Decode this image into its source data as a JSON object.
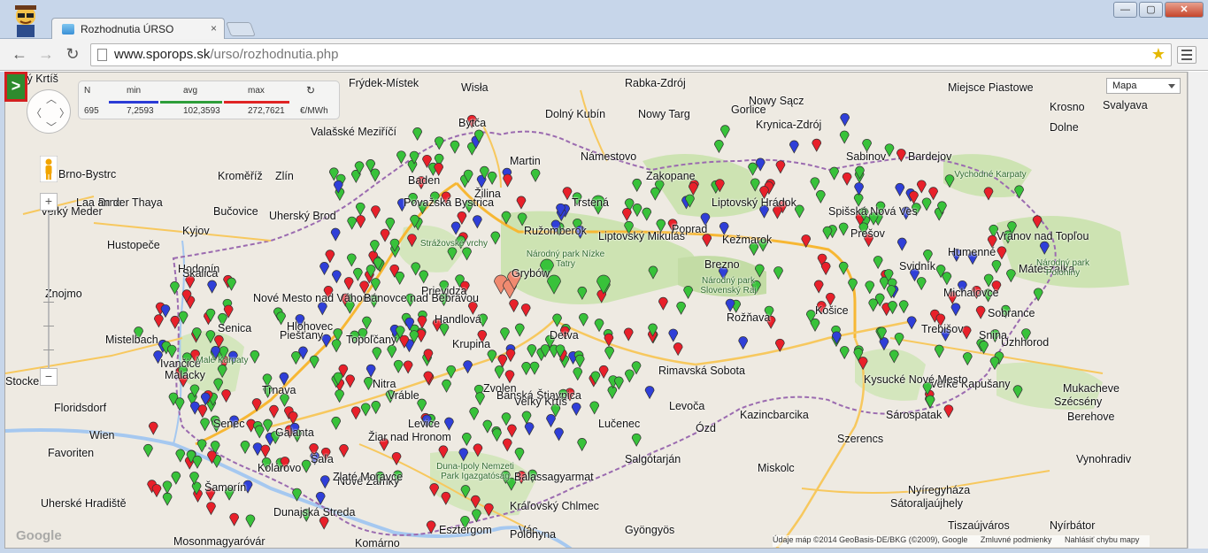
{
  "window": {
    "tab_title": "Rozhodnutia ÚRSO",
    "tab_close": "×",
    "minimize": "—",
    "maximize": "▢",
    "close": "✕"
  },
  "toolbar": {
    "back": "←",
    "forward": "→",
    "reload": "↻",
    "url_host": "www.sporops.sk",
    "url_path": "/urso/rozhodnutia.php",
    "bookmark_icon": "star-icon"
  },
  "map": {
    "toggle_label": ">",
    "map_type": "Mapa",
    "stats": {
      "n_label": "N",
      "min_label": "min",
      "avg_label": "avg",
      "max_label": "max",
      "n_value": "695",
      "min_value": "7,2593",
      "avg_value": "102,3593",
      "max_value": "272,7621",
      "unit": "€/MWh",
      "refresh_icon": "↻",
      "colors": {
        "min": "#2b3bd6",
        "avg": "#2e9e3a",
        "max": "#e02424"
      }
    },
    "footer": {
      "data": "Údaje máp ©2014 GeoBasis-DE/BKG (©2009), Google",
      "terms": "Zmluvné podmienky",
      "report": "Nahlásiť chybu mapy"
    },
    "logo": "Google",
    "marker_colors": {
      "red": "#e8202a",
      "green": "#38c23a",
      "blue": "#2f3fd8",
      "salmon": "#f08a70"
    },
    "labels": [
      {
        "t": "Frýdek-Místek",
        "k": "city"
      },
      {
        "t": "Wisła",
        "k": "city"
      },
      {
        "t": "Rabka-Zdrój",
        "k": "city"
      },
      {
        "t": "Nowy Targ",
        "k": "city"
      },
      {
        "t": "Zakopane",
        "k": "city"
      },
      {
        "t": "Krynica-Zdrój",
        "k": "city"
      },
      {
        "t": "Miejsce Piastowe",
        "k": "city"
      },
      {
        "t": "Krosno",
        "k": "city"
      },
      {
        "t": "Dolne",
        "k": "city"
      },
      {
        "t": "Brno-Bystrc",
        "k": "city"
      },
      {
        "t": "Brno",
        "k": "city"
      },
      {
        "t": "Zlín",
        "k": "city"
      },
      {
        "t": "Kroměříž",
        "k": "city"
      },
      {
        "t": "Valašské Meziříčí",
        "k": "city"
      },
      {
        "t": "Uherský Brod",
        "k": "city"
      },
      {
        "t": "Kyjov",
        "k": "city"
      },
      {
        "t": "Hustopeče",
        "k": "city"
      },
      {
        "t": "Hodonín",
        "k": "city"
      },
      {
        "t": "Mistelbach",
        "k": "city"
      },
      {
        "t": "Wien",
        "k": "city"
      },
      {
        "t": "Floridsdorf",
        "k": "city"
      },
      {
        "t": "Favoriten",
        "k": "city"
      },
      {
        "t": "Stockerau",
        "k": "city"
      },
      {
        "t": "Ružomberok",
        "k": "city"
      },
      {
        "t": "Poprad",
        "k": "city"
      },
      {
        "t": "Prešov",
        "k": "city"
      },
      {
        "t": "Košice",
        "k": "city"
      },
      {
        "t": "Humenné",
        "k": "city"
      },
      {
        "t": "Michalovce",
        "k": "city"
      },
      {
        "t": "Sobrance",
        "k": "city"
      },
      {
        "t": "Uzhhorod",
        "k": "city"
      },
      {
        "t": "Mukacheve",
        "k": "city"
      },
      {
        "t": "Berehove",
        "k": "city"
      },
      {
        "t": "Vynohradiv",
        "k": "city"
      },
      {
        "t": "Trebišov",
        "k": "city"
      },
      {
        "t": "Sárospatak",
        "k": "city"
      },
      {
        "t": "Szerencs",
        "k": "city"
      },
      {
        "t": "Miskolc",
        "k": "city"
      },
      {
        "t": "Nyíregyháza",
        "k": "city"
      },
      {
        "t": "Kazincbarcika",
        "k": "city"
      },
      {
        "t": "Ózd",
        "k": "city"
      },
      {
        "t": "Salgótarján",
        "k": "city"
      },
      {
        "t": "Gyöngyös",
        "k": "city"
      },
      {
        "t": "Balassagyarmat",
        "k": "city"
      },
      {
        "t": "Vác",
        "k": "city"
      },
      {
        "t": "Esztergom",
        "k": "city"
      },
      {
        "t": "Komárno",
        "k": "city"
      },
      {
        "t": "Mosonmagyaróvár",
        "k": "city"
      },
      {
        "t": "Šamorín",
        "k": "city"
      },
      {
        "t": "Senec",
        "k": "city"
      },
      {
        "t": "Trnava",
        "k": "city"
      },
      {
        "t": "Nitra",
        "k": "city"
      },
      {
        "t": "Galanta",
        "k": "city"
      },
      {
        "t": "Šaľa",
        "k": "city"
      },
      {
        "t": "Nové Zámky",
        "k": "city"
      },
      {
        "t": "Levice",
        "k": "city"
      },
      {
        "t": "Zvolen",
        "k": "city"
      },
      {
        "t": "Banská Štiavnica",
        "k": "city"
      },
      {
        "t": "Lučenec",
        "k": "city"
      },
      {
        "t": "Rimavská Sobota",
        "k": "city"
      },
      {
        "t": "Rožňava",
        "k": "city"
      },
      {
        "t": "Detva",
        "k": "city"
      },
      {
        "t": "Handlová",
        "k": "city"
      },
      {
        "t": "Prievidza",
        "k": "city"
      },
      {
        "t": "Topoľčany",
        "k": "city"
      },
      {
        "t": "Piešťany",
        "k": "city"
      },
      {
        "t": "Hlohovec",
        "k": "city"
      },
      {
        "t": "Senica",
        "k": "city"
      },
      {
        "t": "Malacky",
        "k": "city"
      },
      {
        "t": "Skalica",
        "k": "city"
      },
      {
        "t": "Nové Mesto nad Váhom",
        "k": "city"
      },
      {
        "t": "Bánovce nad Bebravou",
        "k": "city"
      },
      {
        "t": "Považská Bystrica",
        "k": "city"
      },
      {
        "t": "Žilina",
        "k": "city"
      },
      {
        "t": "Martin",
        "k": "city"
      },
      {
        "t": "Dolný Kubín",
        "k": "city"
      },
      {
        "t": "Námestovo",
        "k": "city"
      },
      {
        "t": "Trstená",
        "k": "city"
      },
      {
        "t": "Liptovský Mikuláš",
        "k": "city"
      },
      {
        "t": "Liptovský Hrádok",
        "k": "city"
      },
      {
        "t": "Kežmarok",
        "k": "city"
      },
      {
        "t": "Spišská Nová Ves",
        "k": "city"
      },
      {
        "t": "Sabinov",
        "k": "city"
      },
      {
        "t": "Bardejov",
        "k": "city"
      },
      {
        "t": "Svidník",
        "k": "city"
      },
      {
        "t": "Vranov nad Topľou",
        "k": "city"
      },
      {
        "t": "Snina",
        "k": "city"
      },
      {
        "t": "Veľké Kapušany",
        "k": "city"
      },
      {
        "t": "Kráľovský Chlmec",
        "k": "city"
      },
      {
        "t": "Veľký Krtíš",
        "k": "city"
      },
      {
        "t": "Krupina",
        "k": "city"
      },
      {
        "t": "Žiar nad Hronom",
        "k": "city"
      },
      {
        "t": "Vráble",
        "k": "city"
      },
      {
        "t": "Zlaté Moravce",
        "k": "city"
      },
      {
        "t": "Kolárovo",
        "k": "city"
      },
      {
        "t": "Dunajská Streda",
        "k": "city"
      },
      {
        "t": "Veľký Meder",
        "k": "city"
      },
      {
        "t": "Ivančice",
        "k": "city"
      },
      {
        "t": "Znojmo",
        "k": "city"
      },
      {
        "t": "Laa an der Thaya",
        "k": "city"
      },
      {
        "t": "Bučovice",
        "k": "city"
      },
      {
        "t": "Uherské Hradiště",
        "k": "city"
      },
      {
        "t": "Baden",
        "k": "city"
      },
      {
        "t": "Bytča",
        "k": "city"
      },
      {
        "t": "Kysucké Nové Mesto",
        "k": "city"
      },
      {
        "t": "Sátoraljaújhely",
        "k": "city"
      },
      {
        "t": "Tiszaújváros",
        "k": "city"
      },
      {
        "t": "Nyírbátor",
        "k": "city"
      },
      {
        "t": "Mátészalka",
        "k": "city"
      },
      {
        "t": "Polonyna",
        "k": "city"
      },
      {
        "t": "Szécsény",
        "k": "city"
      },
      {
        "t": "Svalyava",
        "k": "city"
      },
      {
        "t": "Gorlice",
        "k": "city"
      },
      {
        "t": "Nowy Sącz",
        "k": "city"
      },
      {
        "t": "Grybów",
        "k": "city"
      },
      {
        "t": "Brezno",
        "k": "city"
      },
      {
        "t": "Levoča",
        "k": "city"
      },
      {
        "t": "Veľký Krtíš",
        "k": "city"
      }
    ],
    "parks": [
      "Národný park Nízke Tatry",
      "Národný park Slovenský Raj",
      "Národný park Poloniny",
      "Vychodné Karpaty",
      "Malé Karpaty",
      "Strážovské vrchy",
      "Duna-Ipoly Nemzeti Park Igazgatóság"
    ]
  }
}
